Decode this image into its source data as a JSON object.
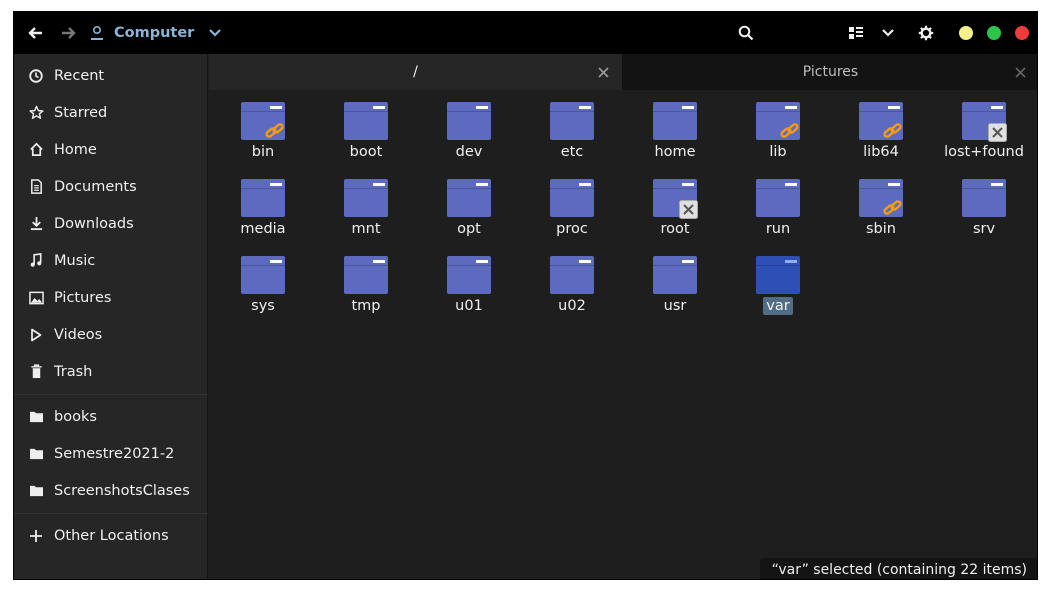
{
  "header": {
    "path_label": "Computer",
    "icons": [
      "back-arrow-icon",
      "forward-arrow-icon",
      "user-icon",
      "chevron-down-icon",
      "search-icon",
      "list-view-icon",
      "chevron-down-icon",
      "gear-icon"
    ],
    "window_controls": {
      "minimize_color": "#f4f18a",
      "maximize_color": "#2ec34a",
      "close_color": "#ee3c3c"
    }
  },
  "sidebar": {
    "places": [
      {
        "label": "Recent",
        "icon": "clock-icon"
      },
      {
        "label": "Starred",
        "icon": "star-icon"
      },
      {
        "label": "Home",
        "icon": "home-icon"
      },
      {
        "label": "Documents",
        "icon": "document-icon"
      },
      {
        "label": "Downloads",
        "icon": "download-icon"
      },
      {
        "label": "Music",
        "icon": "music-icon"
      },
      {
        "label": "Pictures",
        "icon": "image-icon"
      },
      {
        "label": "Videos",
        "icon": "play-icon"
      },
      {
        "label": "Trash",
        "icon": "trash-icon"
      }
    ],
    "bookmarks": [
      {
        "label": "books",
        "icon": "folder-icon"
      },
      {
        "label": "Semestre2021-2",
        "icon": "folder-icon"
      },
      {
        "label": "ScreenshotsClases",
        "icon": "folder-icon"
      }
    ],
    "other": {
      "label": "Other Locations",
      "icon": "plus-icon"
    }
  },
  "tabs": [
    {
      "label": "/",
      "active": true
    },
    {
      "label": "Pictures",
      "active": false
    }
  ],
  "folders": [
    {
      "name": "bin",
      "emblem": "link"
    },
    {
      "name": "boot",
      "emblem": ""
    },
    {
      "name": "dev",
      "emblem": ""
    },
    {
      "name": "etc",
      "emblem": ""
    },
    {
      "name": "home",
      "emblem": ""
    },
    {
      "name": "lib",
      "emblem": "link"
    },
    {
      "name": "lib64",
      "emblem": "link"
    },
    {
      "name": "lost+found",
      "emblem": "locked"
    },
    {
      "name": "media",
      "emblem": ""
    },
    {
      "name": "mnt",
      "emblem": ""
    },
    {
      "name": "opt",
      "emblem": ""
    },
    {
      "name": "proc",
      "emblem": ""
    },
    {
      "name": "root",
      "emblem": "locked"
    },
    {
      "name": "run",
      "emblem": ""
    },
    {
      "name": "sbin",
      "emblem": "link"
    },
    {
      "name": "srv",
      "emblem": ""
    },
    {
      "name": "sys",
      "emblem": ""
    },
    {
      "name": "tmp",
      "emblem": ""
    },
    {
      "name": "u01",
      "emblem": ""
    },
    {
      "name": "u02",
      "emblem": ""
    },
    {
      "name": "usr",
      "emblem": ""
    },
    {
      "name": "var",
      "emblem": "",
      "selected": true
    }
  ],
  "colors": {
    "folder": "#5c6bc0",
    "folder_selected": "#2e4fb5",
    "accent": "#8ab4d8",
    "link_emblem": "#f39c12"
  },
  "status": {
    "text": "“var” selected  (containing 22 items)"
  }
}
